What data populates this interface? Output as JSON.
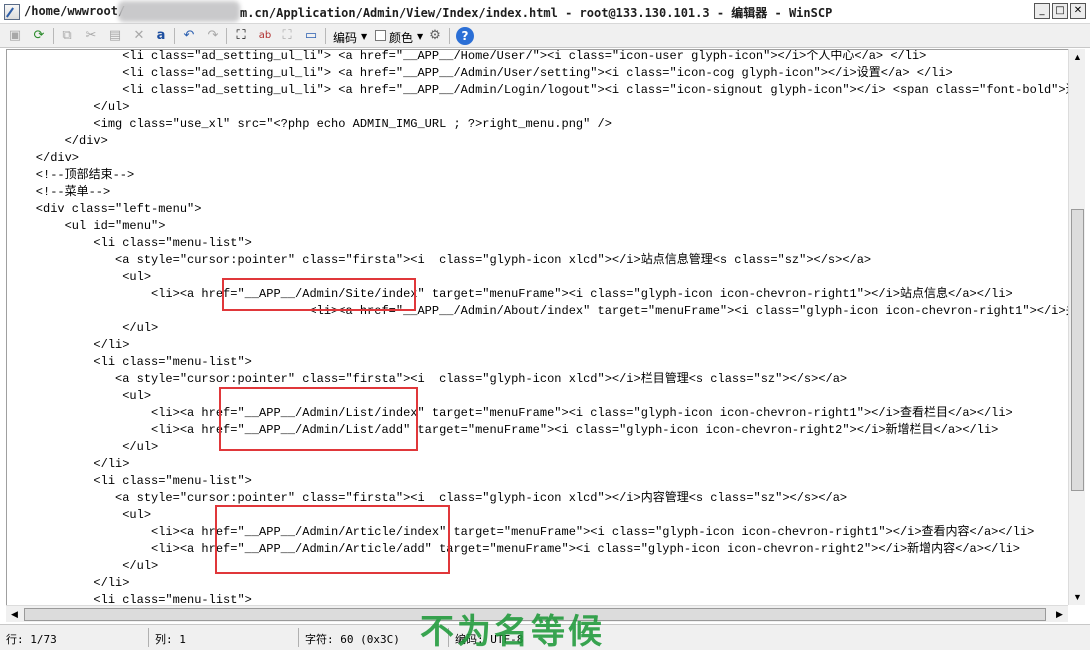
{
  "window": {
    "title_left": "/home/wwwroot/",
    "title_right": "m.cn/Application/Admin/View/Index/index.html - root@133.130.101.3 - 编辑器 - WinSCP",
    "min": "_",
    "max": "□",
    "close": "✕"
  },
  "toolbar": {
    "encoding_label": "编码",
    "color_label": "颜色"
  },
  "code_lines": [
    "                <li class=\"ad_setting_ul_li\"> <a href=\"__APP__/Home/User/\"><i class=\"icon-user glyph-icon\"></i>个人中心</a> </li>",
    "                <li class=\"ad_setting_ul_li\"> <a href=\"__APP__/Admin/User/setting\"><i class=\"icon-cog glyph-icon\"></i>设置</a> </li>",
    "                <li class=\"ad_setting_ul_li\"> <a href=\"__APP__/Admin/Login/logout\"><i class=\"icon-signout glyph-icon\"></i> <span class=\"font-bold\">退出</span> </a> </li>",
    "            </ul>",
    "            <img class=\"use_xl\" src=\"<?php echo ADMIN_IMG_URL ; ?>right_menu.png\" />",
    "        </div>",
    "    </div>",
    "    <!--顶部结束-->",
    "    <!--菜单-->",
    "    <div class=\"left-menu\">",
    "        <ul id=\"menu\">",
    "            <li class=\"menu-list\">",
    "               <a style=\"cursor:pointer\" class=\"firsta\"><i  class=\"glyph-icon xlcd\"></i>站点信息管理<s class=\"sz\"></s></a>",
    "                <ul>",
    "                    <li><a href=\"__APP__/Admin/Site/index\" target=\"menuFrame\"><i class=\"glyph-icon icon-chevron-right1\"></i>站点信息</a></li>",
    "                                          <li><a href=\"__APP__/Admin/About/index\" target=\"menuFrame\"><i class=\"glyph-icon icon-chevron-right1\"></i>关于我们</a></li>",
    "                </ul>",
    "            </li>",
    "            <li class=\"menu-list\">",
    "               <a style=\"cursor:pointer\" class=\"firsta\"><i  class=\"glyph-icon xlcd\"></i>栏目管理<s class=\"sz\"></s></a>",
    "                <ul>",
    "                    <li><a href=\"__APP__/Admin/List/index\" target=\"menuFrame\"><i class=\"glyph-icon icon-chevron-right1\"></i>查看栏目</a></li>",
    "                    <li><a href=\"__APP__/Admin/List/add\" target=\"menuFrame\"><i class=\"glyph-icon icon-chevron-right2\"></i>新增栏目</a></li>",
    "                </ul>",
    "            </li>",
    "            <li class=\"menu-list\">",
    "               <a style=\"cursor:pointer\" class=\"firsta\"><i  class=\"glyph-icon xlcd\"></i>内容管理<s class=\"sz\"></s></a>",
    "                <ul>",
    "                    <li><a href=\"__APP__/Admin/Article/index\" target=\"menuFrame\"><i class=\"glyph-icon icon-chevron-right1\"></i>查看内容</a></li>",
    "                    <li><a href=\"__APP__/Admin/Article/add\" target=\"menuFrame\"><i class=\"glyph-icon icon-chevron-right2\"></i>新增内容</a></li>",
    "                </ul>",
    "            </li>",
    "            <li class=\"menu-list\">"
  ],
  "status": {
    "line": "行: 1/73",
    "col": "列: 1",
    "char": "字符: 60 (0x3C)",
    "encoding": "编码: UTF-8"
  },
  "watermark": "不为名等候"
}
